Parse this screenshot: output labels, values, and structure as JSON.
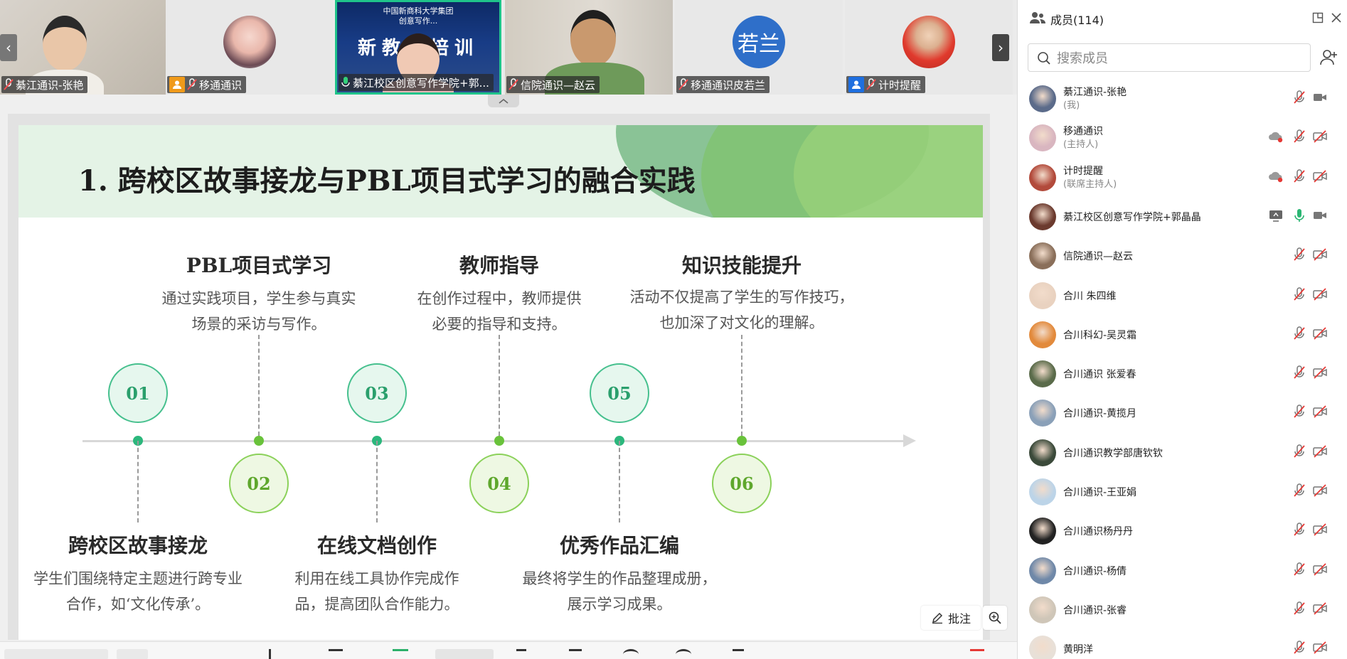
{
  "tiles": [
    {
      "name": "綦江通识-张艳"
    },
    {
      "name": "移通通识"
    },
    {
      "name": "綦江校区创意写作学院+郭..."
    },
    {
      "name": "信院通识—赵云"
    },
    {
      "name": "移通通识皮若兰",
      "avatar_text": "若兰"
    },
    {
      "name": "计时提醒"
    }
  ],
  "banner": {
    "line1": "中国新商科大学集团",
    "line2": "创意写作...",
    "big": "新教师培训"
  },
  "slide": {
    "title": "1. 跨校区故事接龙与PBL项目式学习的融合实践",
    "steps": [
      {
        "num": "01",
        "title": "跨校区故事接龙",
        "desc": "学生们围绕特定主题进行跨专业合作，如‘文化传承’。"
      },
      {
        "num": "02",
        "title": "PBL项目式学习",
        "desc": "通过实践项目，学生参与真实场景的采访与写作。"
      },
      {
        "num": "03",
        "title": "在线文档创作",
        "desc": "利用在线工具协作完成作品，提高团队合作能力。"
      },
      {
        "num": "04",
        "title": "教师指导",
        "desc": "在创作过程中，教师提供必要的指导和支持。"
      },
      {
        "num": "05",
        "title": "优秀作品汇编",
        "desc": "最终将学生的作品整理成册，展示学习成果。"
      },
      {
        "num": "06",
        "title": "知识技能提升",
        "desc": "活动不仅提高了学生的写作技巧，也加深了对文化的理解。"
      }
    ]
  },
  "annotate_label": "批注",
  "panel": {
    "title": "成员(114)",
    "search_placeholder": "搜索成员",
    "members": [
      {
        "name": "綦江通识-张艳",
        "role": "(我)",
        "av": "#5b6b8a"
      },
      {
        "name": "移通通识",
        "role": "(主持人)",
        "av": "#d9b6c0"
      },
      {
        "name": "计时提醒",
        "role": "(联席主持人)",
        "av": "#b24a3b"
      },
      {
        "name": "綦江校区创意写作学院+郭晶晶",
        "role": "",
        "av": "#6b3a2e"
      },
      {
        "name": "信院通识—赵云",
        "role": "",
        "av": "#8a6f5a"
      },
      {
        "name": "合川 朱四维",
        "role": "",
        "av": "#e9d2c0"
      },
      {
        "name": "合川科幻-吴灵霜",
        "role": "",
        "av": "#e28a3c"
      },
      {
        "name": "合川通识 张爱春",
        "role": "",
        "av": "#5a6b4a"
      },
      {
        "name": "合川通识-黄揽月",
        "role": "",
        "av": "#8aa0b8"
      },
      {
        "name": "合川通识教学部唐钦钦",
        "role": "",
        "av": "#3b4a3a"
      },
      {
        "name": "合川通识-王亚娟",
        "role": "",
        "av": "#bcd4e8"
      },
      {
        "name": "合川通识杨丹丹",
        "role": "",
        "av": "#222222"
      },
      {
        "name": "合川通识-杨倩",
        "role": "",
        "av": "#6f88a8"
      },
      {
        "name": "合川通识-张睿",
        "role": "",
        "av": "#cfc6b8"
      },
      {
        "name": "黄明洋",
        "role": "",
        "av": "#e8e0d8"
      }
    ]
  }
}
